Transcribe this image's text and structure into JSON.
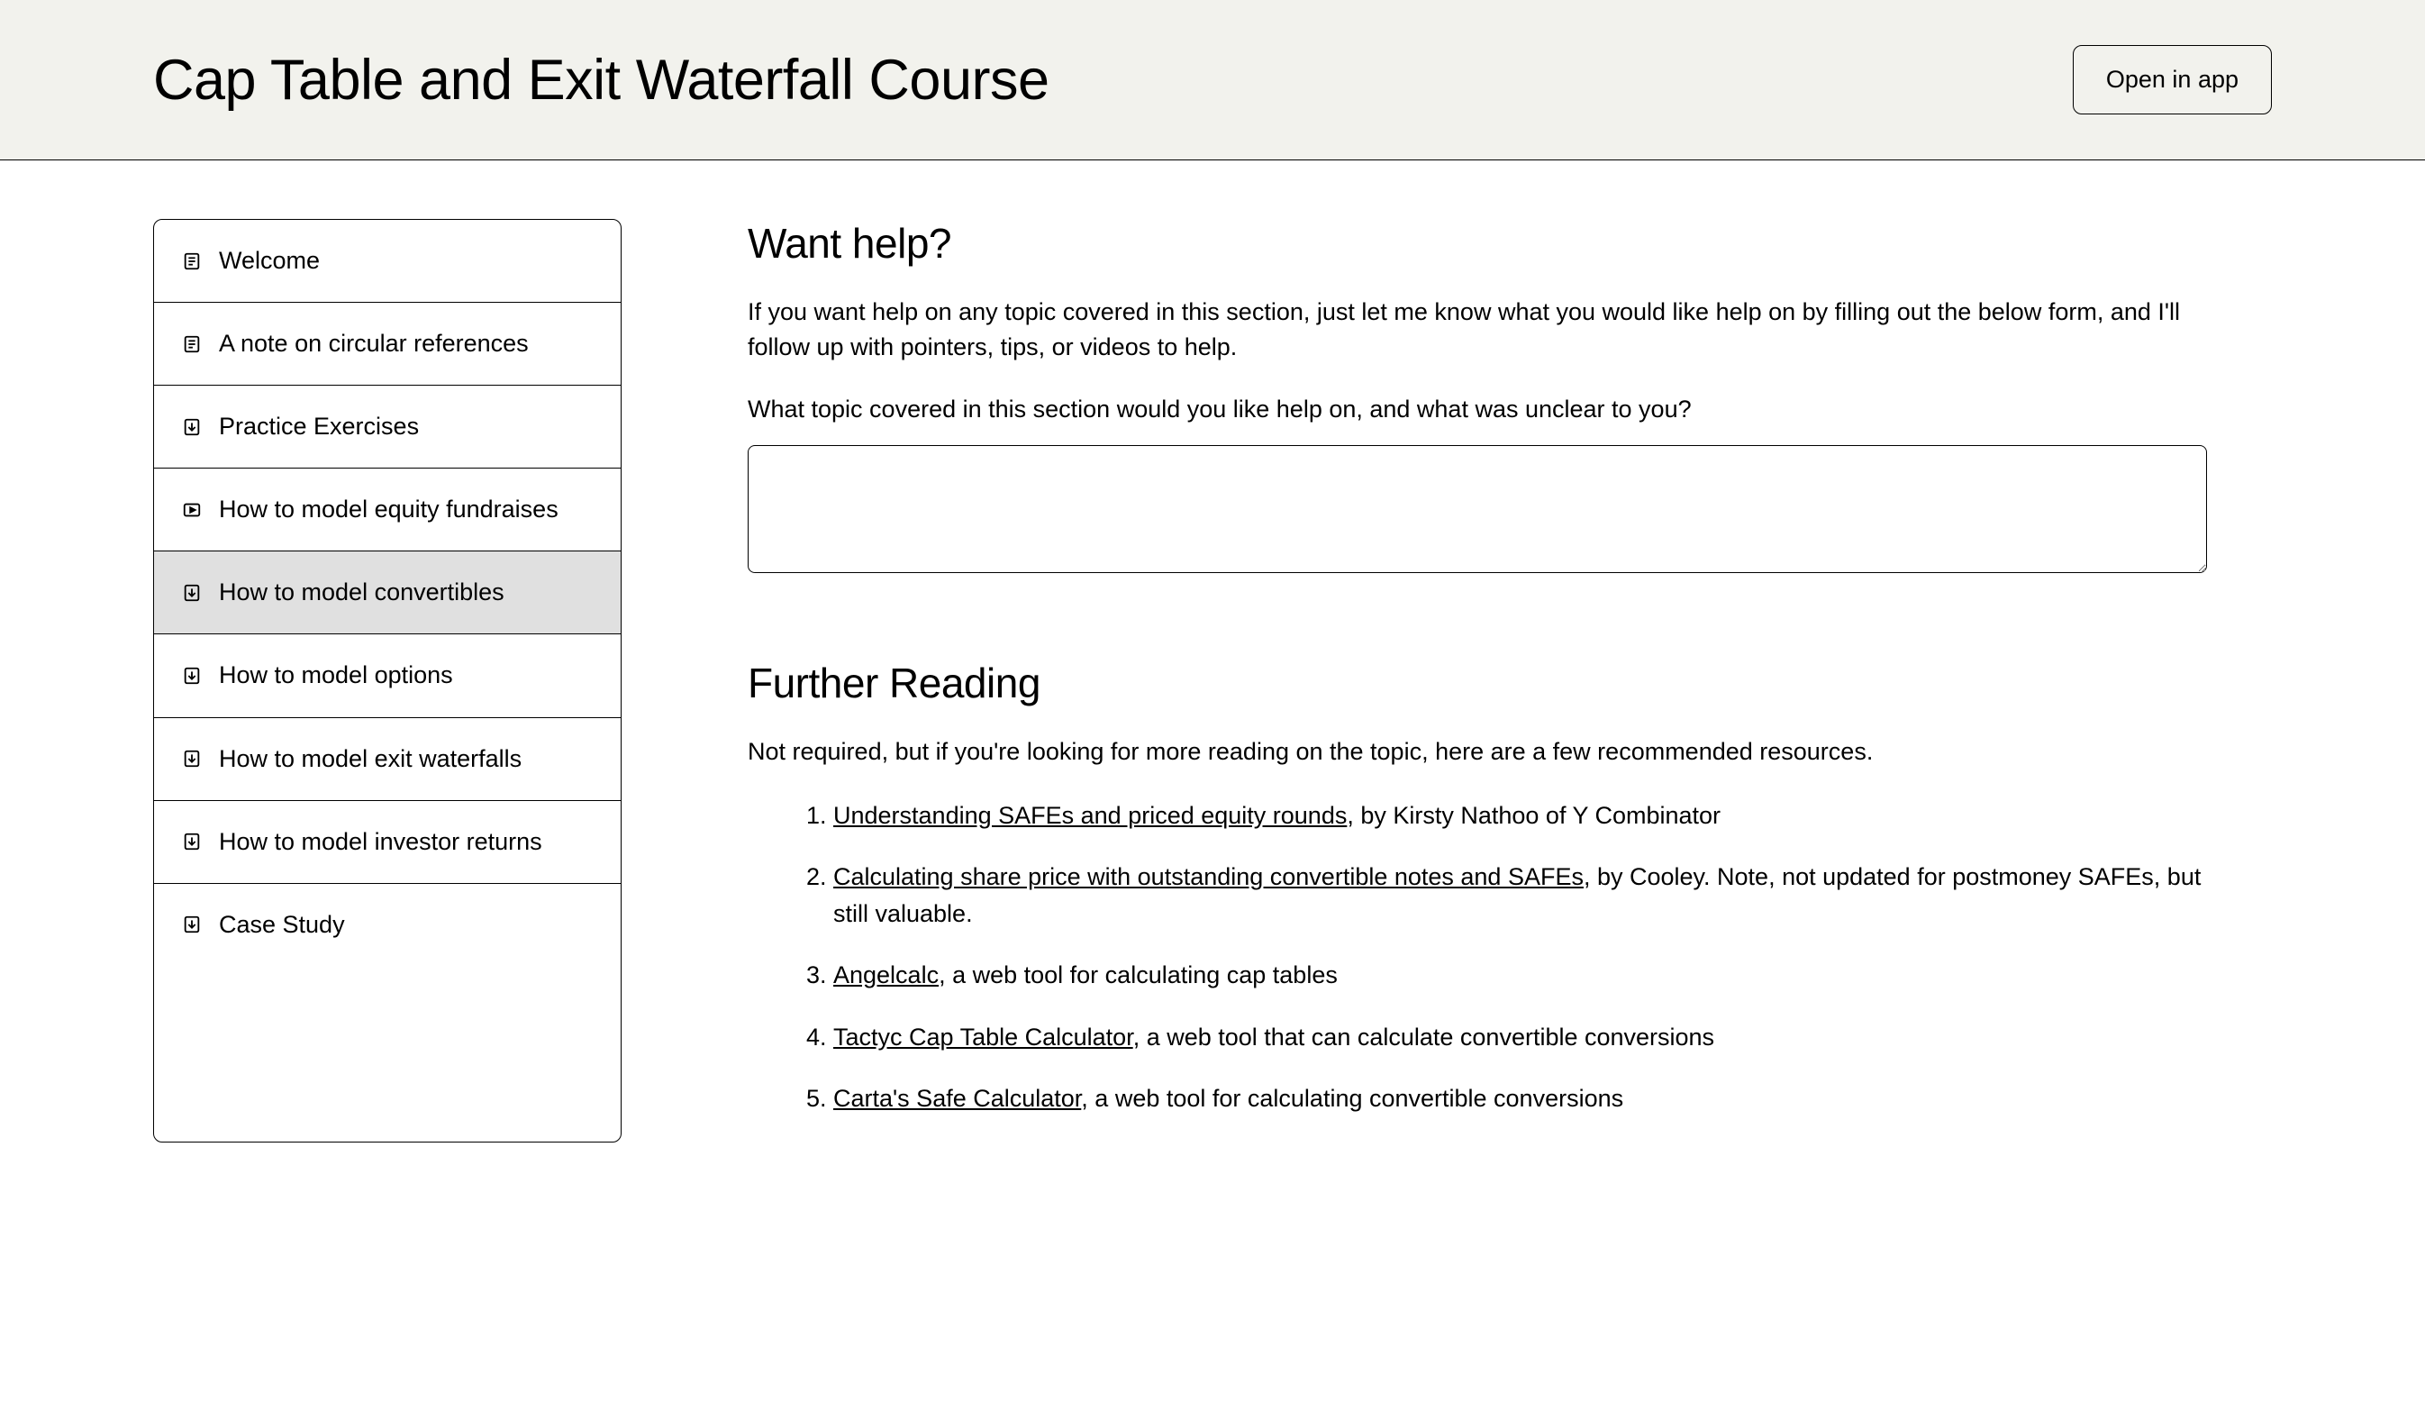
{
  "header": {
    "title": "Cap Table and Exit Waterfall Course",
    "open_in_app_label": "Open in app"
  },
  "sidebar": {
    "items": [
      {
        "label": "Welcome",
        "icon": "text"
      },
      {
        "label": "A note on circular references",
        "icon": "text"
      },
      {
        "label": "Practice Exercises",
        "icon": "download"
      },
      {
        "label": "How to model equity fundraises",
        "icon": "video"
      },
      {
        "label": "How to model convertibles",
        "icon": "download",
        "active": true
      },
      {
        "label": "How to model options",
        "icon": "download"
      },
      {
        "label": "How to model exit waterfalls",
        "icon": "download"
      },
      {
        "label": "How to model investor returns",
        "icon": "download"
      },
      {
        "label": "Case Study",
        "icon": "download"
      }
    ]
  },
  "help_section": {
    "heading": "Want help?",
    "description": "If you want help on any topic covered in this section, just let me know what you would like help on by filling out the below form, and I'll follow up with pointers, tips, or videos to help.",
    "question": "What topic covered in this section would you like help on, and what was unclear to you?"
  },
  "further_reading": {
    "heading": "Further Reading",
    "intro": "Not required, but if you're looking for more reading on the topic, here are a few recommended resources.",
    "items": [
      {
        "link_text": "Understanding SAFEs and priced equity rounds",
        "suffix": ", by Kirsty Nathoo of Y Combinator"
      },
      {
        "link_text": "Calculating share price with outstanding convertible notes and SAFEs",
        "suffix": ", by Cooley. Note, not updated for postmoney SAFEs, but still valuable."
      },
      {
        "link_text": "Angelcalc",
        "suffix": ", a web tool for calculating cap tables"
      },
      {
        "link_text": "Tactyc Cap Table Calculator",
        "suffix": ", a web tool that can calculate convertible conversions"
      },
      {
        "link_text": "Carta's Safe Calculator",
        "suffix": ", a web tool for calculating convertible conversions"
      }
    ]
  }
}
